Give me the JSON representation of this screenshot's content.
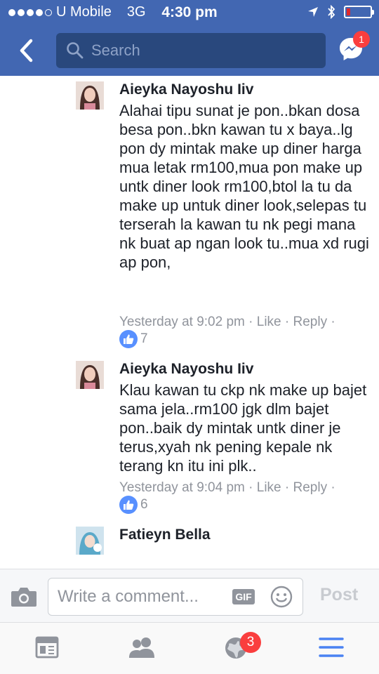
{
  "status_bar": {
    "carrier": "U Mobile",
    "network": "3G",
    "time": "4:30 pm"
  },
  "header": {
    "search_placeholder": "Search",
    "messenger_badge": "1",
    "icons": [
      "back-icon",
      "search-icon",
      "messenger-icon"
    ]
  },
  "comments": [
    {
      "author": "Aieyka Nayoshu Iiv",
      "text": "Alahai tipu sunat je pon..bkan dosa besa pon..bkn kawan tu x baya..lg pon dy mintak make up diner harga mua letak rm100,mua pon make up untk diner look rm100,btol la tu da make up untuk diner look,selepas tu terserah la kawan tu nk pegi mana nk buat ap ngan look tu..mua xd rugi ap pon,",
      "time": "Yesterday at 9:02 pm",
      "like_label": "Like",
      "reply_label": "Reply",
      "like_count": "7"
    },
    {
      "author": "Aieyka Nayoshu Iiv",
      "text": "Klau kawan tu ckp nk make up bajet sama jela..rm100 jgk dlm bajet pon..baik dy mintak untk diner je terus,xyah nk pening kepale nk terang kn itu ini plk..",
      "time": "Yesterday at 9:04 pm",
      "like_label": "Like",
      "reply_label": "Reply",
      "like_count": "6"
    },
    {
      "author": "Fatieyn Bella"
    }
  ],
  "composer": {
    "placeholder": "Write a comment...",
    "gif_label": "GIF",
    "post_label": "Post"
  },
  "tabbar": {
    "notifications_badge": "3",
    "icons": [
      "news-feed-icon",
      "friends-icon",
      "notifications-globe-icon",
      "menu-icon"
    ]
  },
  "colors": {
    "brand": "#4267b2",
    "search_bg": "#29487d",
    "like_blue": "#5890ff",
    "badge_red": "#fa3e3e"
  }
}
